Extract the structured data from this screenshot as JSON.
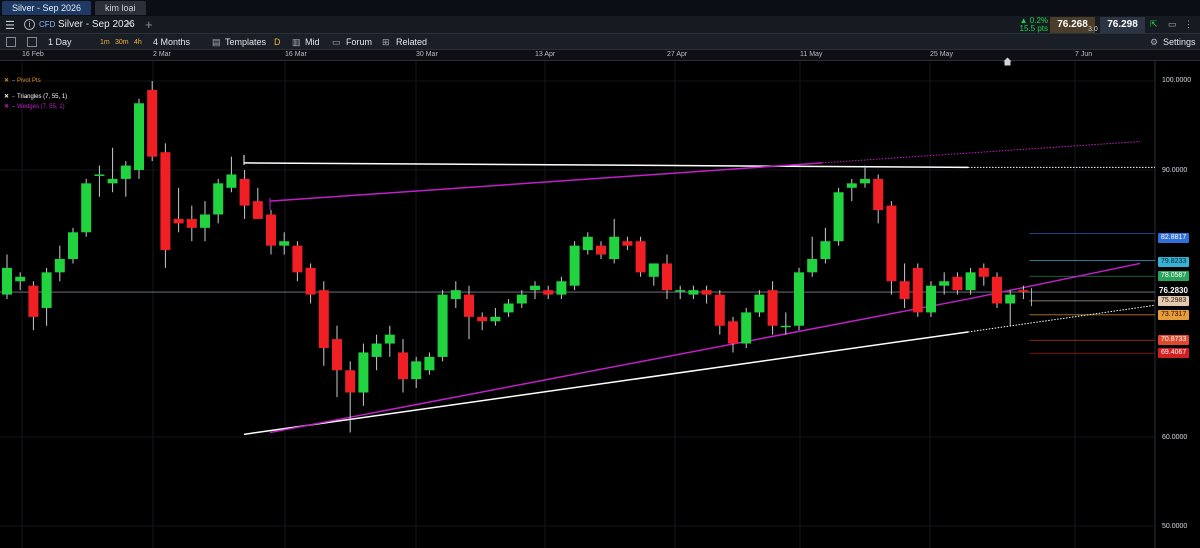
{
  "tabs": [
    {
      "label": "Silver - Sep 2026",
      "active": true
    },
    {
      "label": "kim loại",
      "active": false
    }
  ],
  "header": {
    "instrument_type": "CFD",
    "instrument": "Silver - Sep 2026",
    "change_pct": "▲ 0.2%",
    "change_pts": "15.5 pts",
    "bid": "76.268",
    "spread": "3.0",
    "ask": "76.298",
    "colors": {
      "up": "#22d34a",
      "bid_bg": "#4a3d2a",
      "ask_bg": "#2a3442"
    }
  },
  "toolbar": {
    "interval": "1 Day",
    "quick_intervals": [
      "1m",
      "30m",
      "4h"
    ],
    "span": "4 Months",
    "templates": "Templates",
    "draw": "D",
    "price_type": "Mid",
    "forum": "Forum",
    "related": "Related",
    "settings": "Settings"
  },
  "dates": [
    "16 Feb",
    "2 Mar",
    "16 Mar",
    "30 Mar",
    "13 Apr",
    "27 Apr",
    "11 May",
    "25 May",
    "7 Jun"
  ],
  "legend": [
    {
      "label": "Pivot Pts",
      "color": "#e3902c"
    },
    {
      "label": "Triangles (7, 55, 1)",
      "color": "#ffffff"
    },
    {
      "label": "Wedges (7, 55, 1)",
      "color": "#c020c8"
    }
  ],
  "price_axis": {
    "ticks": [
      "100.0000",
      "90.0000",
      "60.0000",
      "50.0000"
    ],
    "last": "76.2830",
    "levels": [
      {
        "label": "82.8817",
        "color": "#2f6fd8"
      },
      {
        "label": "79.8233",
        "color": "#35b3d6"
      },
      {
        "label": "78.0587",
        "color": "#2aa45a"
      },
      {
        "label": "75.2983",
        "color": "#e4c8b0"
      },
      {
        "label": "73.7317",
        "color": "#e89c3a"
      },
      {
        "label": "70.8733",
        "color": "#e0472c"
      },
      {
        "label": "69.4067",
        "color": "#d02020"
      }
    ]
  },
  "chart_data": {
    "type": "candlestick",
    "y_range": [
      50,
      102
    ],
    "last_price": 76.283,
    "candles": [
      {
        "date": "11 Feb",
        "o": 76.0,
        "h": 80.5,
        "l": 75.5,
        "c": 79.0
      },
      {
        "date": "12 Feb",
        "o": 77.5,
        "h": 78.5,
        "l": 76.5,
        "c": 78.0
      },
      {
        "date": "13 Feb",
        "o": 77.0,
        "h": 77.5,
        "l": 72.0,
        "c": 73.5
      },
      {
        "date": "16 Feb",
        "o": 74.5,
        "h": 79.0,
        "l": 72.5,
        "c": 78.5
      },
      {
        "date": "17 Feb",
        "o": 78.5,
        "h": 81.5,
        "l": 77.5,
        "c": 80.0
      },
      {
        "date": "18 Feb",
        "o": 80.0,
        "h": 83.5,
        "l": 79.5,
        "c": 83.0
      },
      {
        "date": "19 Feb",
        "o": 83.0,
        "h": 89.0,
        "l": 82.5,
        "c": 88.5
      },
      {
        "date": "20 Feb",
        "o": 89.5,
        "h": 90.5,
        "l": 87.0,
        "c": 89.5
      },
      {
        "date": "23 Feb",
        "o": 88.5,
        "h": 92.5,
        "l": 87.5,
        "c": 89.0
      },
      {
        "date": "24 Feb",
        "o": 89.0,
        "h": 91.0,
        "l": 87.0,
        "c": 90.5
      },
      {
        "date": "25 Feb",
        "o": 90.0,
        "h": 98.0,
        "l": 89.0,
        "c": 97.5
      },
      {
        "date": "26 Feb",
        "o": 99.0,
        "h": 100.0,
        "l": 91.0,
        "c": 91.5
      },
      {
        "date": "27 Feb",
        "o": 92.0,
        "h": 93.0,
        "l": 79.0,
        "c": 81.0
      },
      {
        "date": "2 Mar",
        "o": 84.5,
        "h": 88.0,
        "l": 83.0,
        "c": 84.0
      },
      {
        "date": "3 Mar",
        "o": 84.5,
        "h": 86.0,
        "l": 82.0,
        "c": 83.5
      },
      {
        "date": "4 Mar",
        "o": 83.5,
        "h": 86.5,
        "l": 82.0,
        "c": 85.0
      },
      {
        "date": "5 Mar",
        "o": 85.0,
        "h": 89.0,
        "l": 84.0,
        "c": 88.5
      },
      {
        "date": "6 Mar",
        "o": 88.0,
        "h": 91.5,
        "l": 87.5,
        "c": 89.5
      },
      {
        "date": "9 Mar",
        "o": 89.0,
        "h": 90.0,
        "l": 84.5,
        "c": 86.0
      },
      {
        "date": "10 Mar",
        "o": 86.5,
        "h": 88.0,
        "l": 85.0,
        "c": 84.5
      },
      {
        "date": "11 Mar",
        "o": 85.0,
        "h": 85.5,
        "l": 80.5,
        "c": 81.5
      },
      {
        "date": "12 Mar",
        "o": 81.5,
        "h": 83.0,
        "l": 80.5,
        "c": 82.0
      },
      {
        "date": "13 Mar",
        "o": 81.5,
        "h": 82.0,
        "l": 77.5,
        "c": 78.5
      },
      {
        "date": "16 Mar",
        "o": 79.0,
        "h": 79.5,
        "l": 75.0,
        "c": 76.0
      },
      {
        "date": "17 Mar",
        "o": 76.5,
        "h": 77.5,
        "l": 68.0,
        "c": 70.0
      },
      {
        "date": "18 Mar",
        "o": 71.0,
        "h": 72.5,
        "l": 64.5,
        "c": 67.5
      },
      {
        "date": "19 Mar",
        "o": 67.5,
        "h": 68.5,
        "l": 60.5,
        "c": 65.0
      },
      {
        "date": "20 Mar",
        "o": 65.0,
        "h": 70.5,
        "l": 63.5,
        "c": 69.5
      },
      {
        "date": "23 Mar",
        "o": 69.0,
        "h": 71.5,
        "l": 67.5,
        "c": 70.5
      },
      {
        "date": "24 Mar",
        "o": 70.5,
        "h": 72.5,
        "l": 69.0,
        "c": 71.5
      },
      {
        "date": "25 Mar",
        "o": 69.5,
        "h": 71.0,
        "l": 65.0,
        "c": 66.5
      },
      {
        "date": "26 Mar",
        "o": 66.5,
        "h": 69.0,
        "l": 65.5,
        "c": 68.5
      },
      {
        "date": "27 Mar",
        "o": 67.5,
        "h": 69.5,
        "l": 67.0,
        "c": 69.0
      },
      {
        "date": "30 Mar",
        "o": 69.0,
        "h": 76.5,
        "l": 68.5,
        "c": 76.0
      },
      {
        "date": "31 Mar",
        "o": 75.5,
        "h": 77.5,
        "l": 74.5,
        "c": 76.5
      },
      {
        "date": "1 Apr",
        "o": 76.0,
        "h": 77.0,
        "l": 71.0,
        "c": 73.5
      },
      {
        "date": "2 Apr",
        "o": 73.5,
        "h": 74.0,
        "l": 72.0,
        "c": 73.0
      },
      {
        "date": "3 Apr",
        "o": 73.0,
        "h": 74.5,
        "l": 72.5,
        "c": 73.5
      },
      {
        "date": "6 Apr",
        "o": 74.0,
        "h": 75.5,
        "l": 73.5,
        "c": 75.0
      },
      {
        "date": "7 Apr",
        "o": 75.0,
        "h": 76.5,
        "l": 74.5,
        "c": 76.0
      },
      {
        "date": "8 Apr",
        "o": 76.5,
        "h": 77.5,
        "l": 75.5,
        "c": 77.0
      },
      {
        "date": "9 Apr",
        "o": 76.5,
        "h": 77.0,
        "l": 75.5,
        "c": 76.0
      },
      {
        "date": "10 Apr",
        "o": 76.0,
        "h": 78.0,
        "l": 75.5,
        "c": 77.5
      },
      {
        "date": "13 Apr",
        "o": 77.0,
        "h": 82.0,
        "l": 76.5,
        "c": 81.5
      },
      {
        "date": "14 Apr",
        "o": 81.0,
        "h": 83.0,
        "l": 80.5,
        "c": 82.5
      },
      {
        "date": "15 Apr",
        "o": 81.5,
        "h": 82.0,
        "l": 80.0,
        "c": 80.5
      },
      {
        "date": "16 Apr",
        "o": 80.0,
        "h": 84.5,
        "l": 79.5,
        "c": 82.5
      },
      {
        "date": "17 Apr",
        "o": 82.0,
        "h": 82.5,
        "l": 81.0,
        "c": 81.5
      },
      {
        "date": "20 Apr",
        "o": 82.0,
        "h": 82.5,
        "l": 78.0,
        "c": 78.5
      },
      {
        "date": "21 Apr",
        "o": 78.0,
        "h": 79.5,
        "l": 77.0,
        "c": 79.5
      },
      {
        "date": "22 Apr",
        "o": 79.5,
        "h": 80.5,
        "l": 75.5,
        "c": 76.5
      },
      {
        "date": "23 Apr",
        "o": 76.5,
        "h": 77.0,
        "l": 75.5,
        "c": 76.5
      },
      {
        "date": "24 Apr",
        "o": 76.0,
        "h": 77.0,
        "l": 75.5,
        "c": 76.5
      },
      {
        "date": "27 Apr",
        "o": 76.5,
        "h": 77.0,
        "l": 75.0,
        "c": 76.0
      },
      {
        "date": "28 Apr",
        "o": 76.0,
        "h": 76.5,
        "l": 71.5,
        "c": 72.5
      },
      {
        "date": "29 Apr",
        "o": 73.0,
        "h": 73.5,
        "l": 69.5,
        "c": 70.5
      },
      {
        "date": "30 Apr",
        "o": 70.5,
        "h": 74.5,
        "l": 70.0,
        "c": 74.0
      },
      {
        "date": "1 May",
        "o": 74.0,
        "h": 76.5,
        "l": 73.5,
        "c": 76.0
      },
      {
        "date": "4 May",
        "o": 76.5,
        "h": 77.5,
        "l": 71.5,
        "c": 72.5
      },
      {
        "date": "5 May",
        "o": 72.5,
        "h": 74.0,
        "l": 71.5,
        "c": 72.5
      },
      {
        "date": "6 May",
        "o": 72.5,
        "h": 79.0,
        "l": 72.0,
        "c": 78.5
      },
      {
        "date": "7 May",
        "o": 78.5,
        "h": 82.5,
        "l": 78.0,
        "c": 80.0
      },
      {
        "date": "8 May",
        "o": 80.0,
        "h": 83.5,
        "l": 79.5,
        "c": 82.0
      },
      {
        "date": "11 May",
        "o": 82.0,
        "h": 88.0,
        "l": 81.5,
        "c": 87.5
      },
      {
        "date": "12 May",
        "o": 88.0,
        "h": 89.0,
        "l": 86.5,
        "c": 88.5
      },
      {
        "date": "13 May",
        "o": 88.5,
        "h": 90.5,
        "l": 88.0,
        "c": 89.0
      },
      {
        "date": "14 May",
        "o": 89.0,
        "h": 89.5,
        "l": 84.0,
        "c": 85.5
      },
      {
        "date": "15 May",
        "o": 86.0,
        "h": 86.5,
        "l": 76.0,
        "c": 77.5
      },
      {
        "date": "18 May",
        "o": 77.5,
        "h": 79.5,
        "l": 74.5,
        "c": 75.5
      },
      {
        "date": "19 May",
        "o": 79.0,
        "h": 79.5,
        "l": 73.5,
        "c": 74.0
      },
      {
        "date": "20 May",
        "o": 74.0,
        "h": 77.5,
        "l": 73.5,
        "c": 77.0
      },
      {
        "date": "21 May",
        "o": 77.0,
        "h": 78.5,
        "l": 76.0,
        "c": 77.5
      },
      {
        "date": "22 May",
        "o": 78.0,
        "h": 78.5,
        "l": 76.0,
        "c": 76.5
      },
      {
        "date": "25 May",
        "o": 76.5,
        "h": 79.0,
        "l": 76.0,
        "c": 78.5
      },
      {
        "date": "26 May",
        "o": 79.0,
        "h": 79.5,
        "l": 77.0,
        "c": 78.0
      },
      {
        "date": "27 May",
        "o": 78.0,
        "h": 78.5,
        "l": 74.5,
        "c": 75.0
      },
      {
        "date": "28 May",
        "o": 75.0,
        "h": 76.5,
        "l": 72.5,
        "c": 76.0
      },
      {
        "date": "29 May",
        "o": 76.5,
        "h": 77.0,
        "l": 75.5,
        "c": 76.3
      }
    ]
  }
}
